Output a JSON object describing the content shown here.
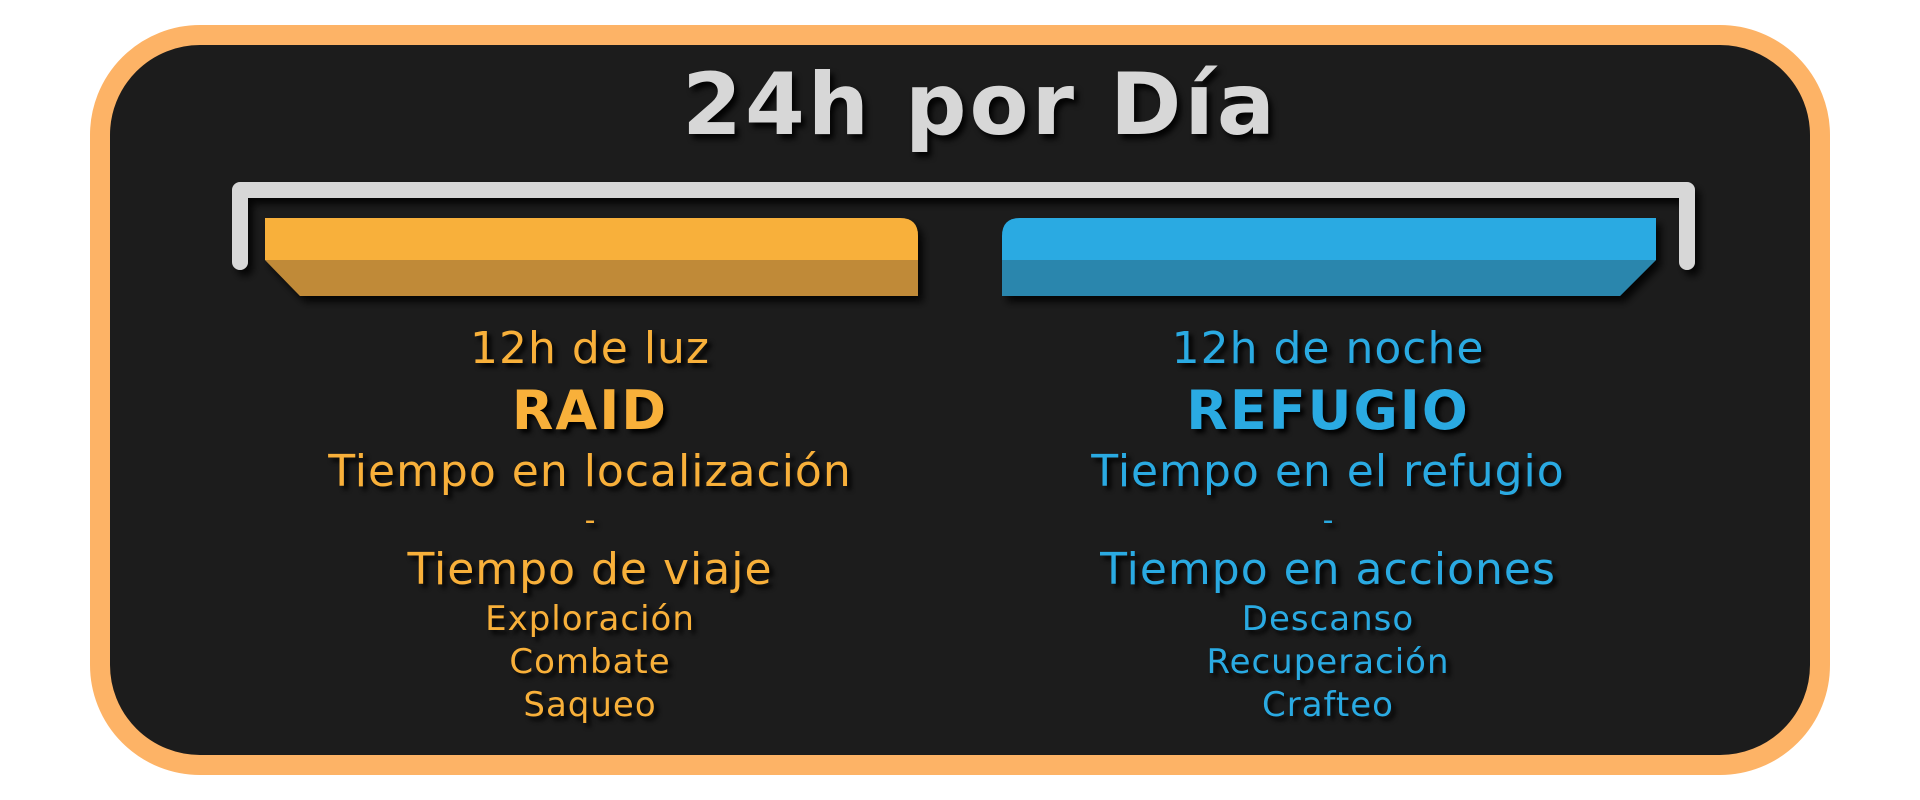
{
  "title": "24h por Día",
  "colors": {
    "frame_border": "#fdb366",
    "frame_fill": "#1c1c1c",
    "bracket": "#d7d7d7",
    "day_accent": "#f8b03a",
    "day_shade": "#c08a38",
    "night_accent": "#2aaae2",
    "night_shade": "#2b86ad"
  },
  "day": {
    "period": "12h de luz",
    "name": "RAID",
    "time_label": "Tiempo en localización",
    "separator": "-",
    "subtime_label": "Tiempo de viaje",
    "activities": [
      "Exploración",
      "Combate",
      "Saqueo"
    ]
  },
  "night": {
    "period": "12h de noche",
    "name": "REFUGIO",
    "time_label": "Tiempo en el refugio",
    "separator": "-",
    "subtime_label": "Tiempo en acciones",
    "activities": [
      "Descanso",
      "Recuperación",
      "Crafteo"
    ]
  }
}
